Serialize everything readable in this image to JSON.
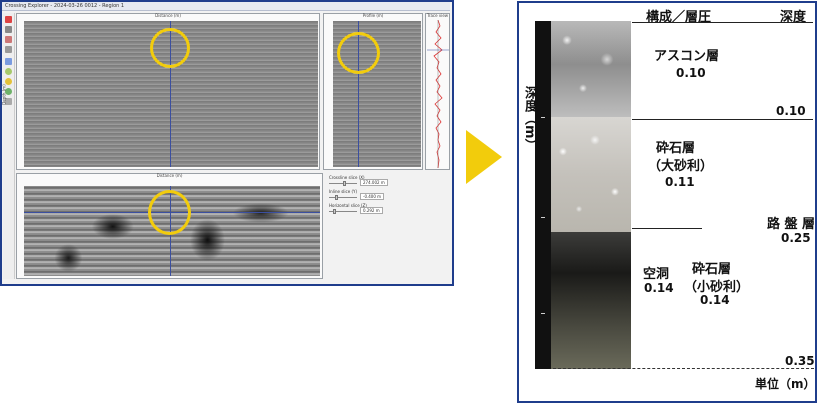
{
  "software": {
    "title": "Crossing Explorer - 2024-03-26 0012 - Region 1",
    "bscan_header": "Distance (m)",
    "profile_header": "Profile (m)",
    "trace_header": "Trace view",
    "slice_header": "Distance (m)",
    "depth_axis": "Depth (m)",
    "controls": [
      {
        "label": "Crossline slice (X)",
        "value": "274.002 m"
      },
      {
        "label": "Inline slice (Y)",
        "value": "-0.400 m"
      },
      {
        "label": "Horizontal slice (Z)",
        "value": "0.292 m"
      }
    ]
  },
  "figure": {
    "header_left": "構成／層圧",
    "header_right": "深度",
    "vertical_axis": "深度（m）",
    "layers": [
      {
        "name": "アスコン層",
        "thickness": "0.10"
      },
      {
        "name_line1": "砕石層",
        "name_line2": "（大砂利）",
        "thickness": "0.11"
      },
      {
        "name": "空洞",
        "thickness": "0.14"
      },
      {
        "name_line1": "砕石層",
        "name_line2": "（小砂利）",
        "thickness": "0.14"
      }
    ],
    "roadbed": {
      "name": "路 盤 層",
      "thickness": "0.25"
    },
    "depths": [
      "0.10",
      "0.35"
    ],
    "unit": "単位（m）"
  },
  "colors": {
    "frame": "#1f3d8c",
    "highlight": "#f2cc0c",
    "crosshair": "#3b4fa0"
  },
  "icons": [
    "arrow-right-icon",
    "highlight-circle-icon"
  ]
}
